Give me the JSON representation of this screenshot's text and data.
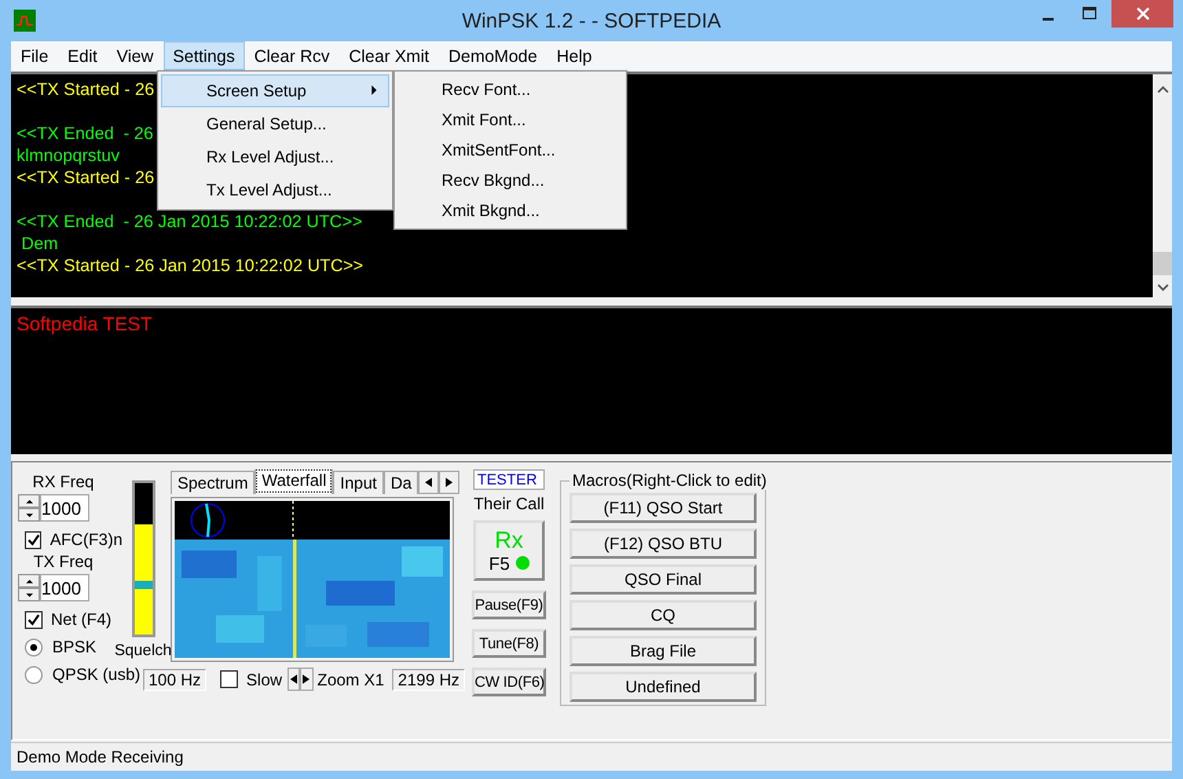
{
  "window": {
    "title": "WinPSK 1.2 - - SOFTPEDIA"
  },
  "menu": [
    {
      "label": "File",
      "selected": false
    },
    {
      "label": "Edit",
      "selected": false
    },
    {
      "label": "View",
      "selected": false
    },
    {
      "label": "Settings",
      "selected": true
    },
    {
      "label": "Clear Rcv",
      "selected": false
    },
    {
      "label": "Clear Xmit",
      "selected": false
    },
    {
      "label": "DemoMode",
      "selected": false
    },
    {
      "label": "Help",
      "selected": false
    }
  ],
  "settings_menu": [
    {
      "label": "Screen Setup",
      "selected": true,
      "submenu": true
    },
    {
      "label": "General Setup...",
      "selected": false,
      "submenu": false
    },
    {
      "label": "Rx Level Adjust...",
      "selected": false,
      "submenu": false
    },
    {
      "label": "Tx Level Adjust...",
      "selected": false,
      "submenu": false
    }
  ],
  "screen_setup_menu": [
    "Recv Font...",
    "Xmit Font...",
    "XmitSentFont...",
    "Recv Bkgnd...",
    "Xmit Bkgnd..."
  ],
  "receive_blocks": [
    [
      {
        "text": "<<TX Started - 26",
        "color": "#ffff00"
      }
    ],
    [
      {
        "text": "<<TX Ended  - 26",
        "color": "#00ff00"
      },
      {
        "text": "klmnopqrstuv",
        "color": "#00ff00"
      },
      {
        "text": "<<TX Started - 26",
        "color": "#ffff00"
      }
    ],
    [
      {
        "text": "<<TX Ended  - 26 Jan 2015 10:22:02 UTC>>",
        "color": "#00ff00"
      },
      {
        "text": " Dem",
        "color": "#00ff00"
      },
      {
        "text": "<<TX Started - 26 Jan 2015 10:22:02 UTC>>",
        "color": "#ffff00"
      }
    ]
  ],
  "transmit_text": "Softpedia TEST",
  "rx_freq": {
    "label": "RX Freq",
    "value": "1000"
  },
  "afc": {
    "label": "AFC(F3)n",
    "checked": true
  },
  "tx_freq": {
    "label": "TX Freq",
    "value": "1000"
  },
  "net": {
    "label": "Net (F4)",
    "checked": true
  },
  "modes": [
    {
      "label": "BPSK",
      "selected": true
    },
    {
      "label": "QPSK (usb)",
      "selected": false
    }
  ],
  "squelch": {
    "label": "Squelch",
    "signal": {
      "level": 0.73
    },
    "threshold": {
      "level": 0.33
    }
  },
  "tabs": [
    {
      "label": "Spectrum",
      "selected": false
    },
    {
      "label": "Waterfall",
      "selected": true
    },
    {
      "label": "Input",
      "selected": false
    },
    {
      "label": "Da",
      "selected": false
    }
  ],
  "scale": {
    "low": "100 Hz",
    "high": "2199 Hz",
    "zoom": "Zoom X1"
  },
  "slow": {
    "label": "Slow",
    "checked": false
  },
  "their_call": {
    "value": "TESTER",
    "label": "Their Call"
  },
  "rx_button": {
    "label": "Rx",
    "key": "F5"
  },
  "side_buttons": [
    "Pause(F9)",
    "Tune(F8)",
    "CW ID(F6)"
  ],
  "macros": {
    "title": "Macros(Right-Click to edit)",
    "buttons": [
      "(F11) QSO Start",
      "(F12) QSO BTU",
      "QSO Final",
      "CQ",
      "Brag File",
      "Undefined"
    ]
  },
  "status_bar": "Demo Mode Receiving"
}
